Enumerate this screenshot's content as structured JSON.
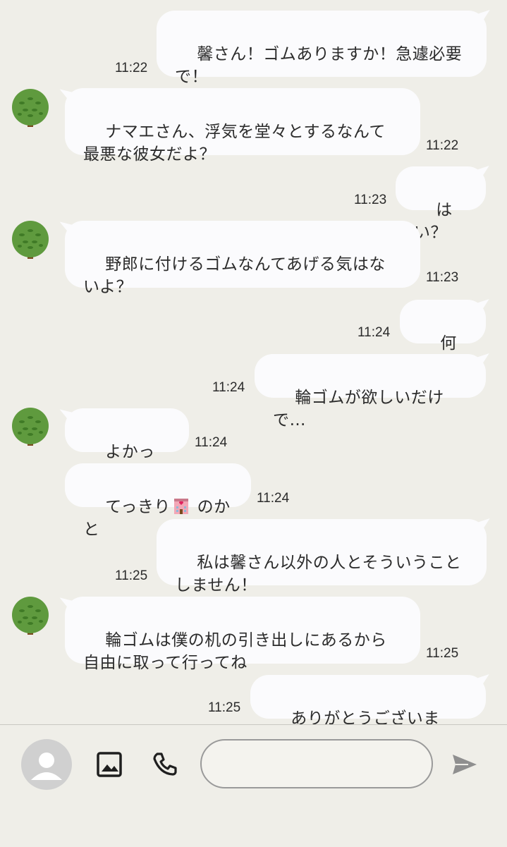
{
  "messages": [
    {
      "side": "me",
      "text": "馨さん！ゴムありますか！急遽必要\nで！",
      "time": "11:22"
    },
    {
      "side": "them",
      "text": "ナマエさん、浮気を堂々とするなんて\n最悪な彼女だよ？",
      "time": "11:22"
    },
    {
      "side": "me",
      "text": "はい？",
      "time": "11:23"
    },
    {
      "side": "them",
      "text": "野郎に付けるゴムなんてあげる気はな\nいよ？",
      "time": "11:23"
    },
    {
      "side": "me",
      "text": "何を…",
      "time": "11:24"
    },
    {
      "side": "me",
      "text": "輪ゴムが欲しいだけで…",
      "time": "11:24"
    },
    {
      "side": "them",
      "text": "よかった…",
      "time": "11:24"
    },
    {
      "side": "them",
      "text_before": "てっきり",
      "emoji": "love-hotel",
      "text_after": " のかと",
      "time": "11:24"
    },
    {
      "side": "me",
      "text": "私は馨さん以外の人とそういうこと\nしません！",
      "time": "11:25"
    },
    {
      "side": "them",
      "text": "輪ゴムは僕の机の引き出しにあるから\n自由に取って行ってね",
      "time": "11:25"
    },
    {
      "side": "me",
      "text": "ありがとうございます！",
      "time": "11:25"
    }
  ],
  "input": {
    "placeholder": ""
  },
  "icons": {
    "avatar": "tree-icon",
    "user": "person-icon",
    "image": "image-icon",
    "phone": "phone-icon",
    "send": "send-icon",
    "emoji": "love-hotel-emoji"
  },
  "colors": {
    "background": "#efeee8",
    "bubble": "#fbfbfd",
    "tree": "#5f9a3e"
  }
}
